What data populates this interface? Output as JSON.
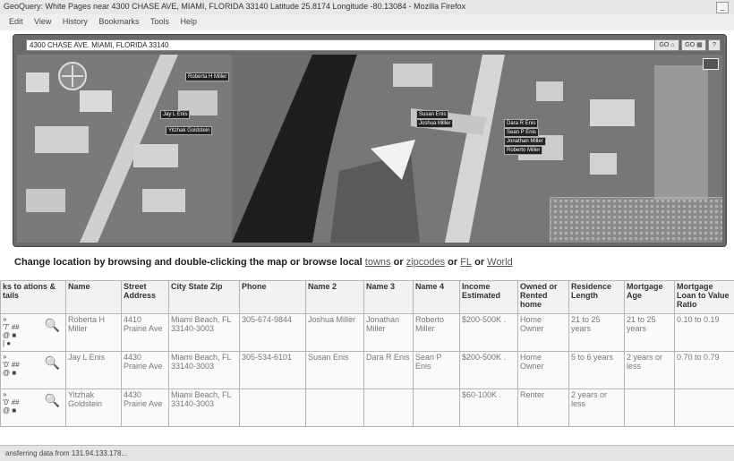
{
  "window": {
    "title": "GeoQuery: White Pages near 4300 CHASE AVE, MIAMI, FLORIDA 33140 Latitude 25.8174 Longitude -80.13084 - Mozilla Firefox",
    "minimize": "_"
  },
  "menu": [
    "Edit",
    "View",
    "History",
    "Bookmarks",
    "Tools",
    "Help"
  ],
  "search": {
    "value": "4300 CHASE AVE. MIAMI, FLORIDA 33140",
    "go_label": "GO",
    "go2_label": "GO",
    "help_label": "?"
  },
  "map": {
    "labels": [
      "Roberta H Miller",
      "Jay L Enis",
      "Yitzhak Goldstein",
      "Susan Enis",
      "Joshua Miller",
      "Dara R Enis",
      "Sean P Enis",
      "Jonathan Miller",
      "Roberto Miller"
    ]
  },
  "instructions": {
    "text": "Change location by browsing and double-clicking the map or browse local",
    "links": [
      "towns",
      "zipcodes",
      "FL",
      "World"
    ],
    "or": "or"
  },
  "table": {
    "headers": [
      "ks to ations & tails",
      "Name",
      "Street Address",
      "City State Zip",
      "Phone",
      "Name 2",
      "Name 3",
      "Name 4",
      "Income Estimated",
      "Owned or Rented home",
      "Residence Length",
      "Mortgage Age",
      "Mortgage Loan to Value Ratio"
    ],
    "rows": [
      {
        "name": "Roberta H Miller",
        "street": "4410 Prairie Ave",
        "city": "Miami Beach, FL 33140-3003",
        "phone": "305-674-9844",
        "name2": "Joshua Miller",
        "name3": "Jonathan Miller",
        "name4": "Roberto Miller",
        "income": "$200-500K .",
        "owned": "Home Owner",
        "residence": "21 to 25 years",
        "mortgage_age": "21 to 25 years",
        "ltv": "0.10 to 0.19"
      },
      {
        "name": "Jay L Enis",
        "street": "4430 Prairie Ave",
        "city": "Miami Beach, FL 33140-3003",
        "phone": "305-534-6101",
        "name2": "Susan Enis",
        "name3": "Dara R Enis",
        "name4": "Sean P Enis",
        "income": "$200-500K .",
        "owned": "Home Owner",
        "residence": "5 to 6 years",
        "mortgage_age": "2 years or less",
        "ltv": "0.70 to 0.79"
      },
      {
        "name": "Yitzhak Goldstein",
        "street": "4430 Prairie Ave",
        "city": "Miami Beach, FL 33140-3003",
        "phone": "",
        "name2": "",
        "name3": "",
        "name4": "",
        "income": "$60-100K .",
        "owned": "Renter",
        "residence": "2 years or less",
        "mortgage_age": "",
        "ltv": ""
      }
    ],
    "row_icons": [
      {
        "line1": "»",
        "line2": "'7' ##",
        "line3": "@ ■",
        "line4": "| ●"
      },
      {
        "line1": "»",
        "line2": "'0' ##",
        "line3": "@ ■",
        "line4": ""
      },
      {
        "line1": "»",
        "line2": "'0' ##",
        "line3": "@ ■",
        "line4": ""
      }
    ]
  },
  "status": "ansferring data from 131.94.133.178..."
}
